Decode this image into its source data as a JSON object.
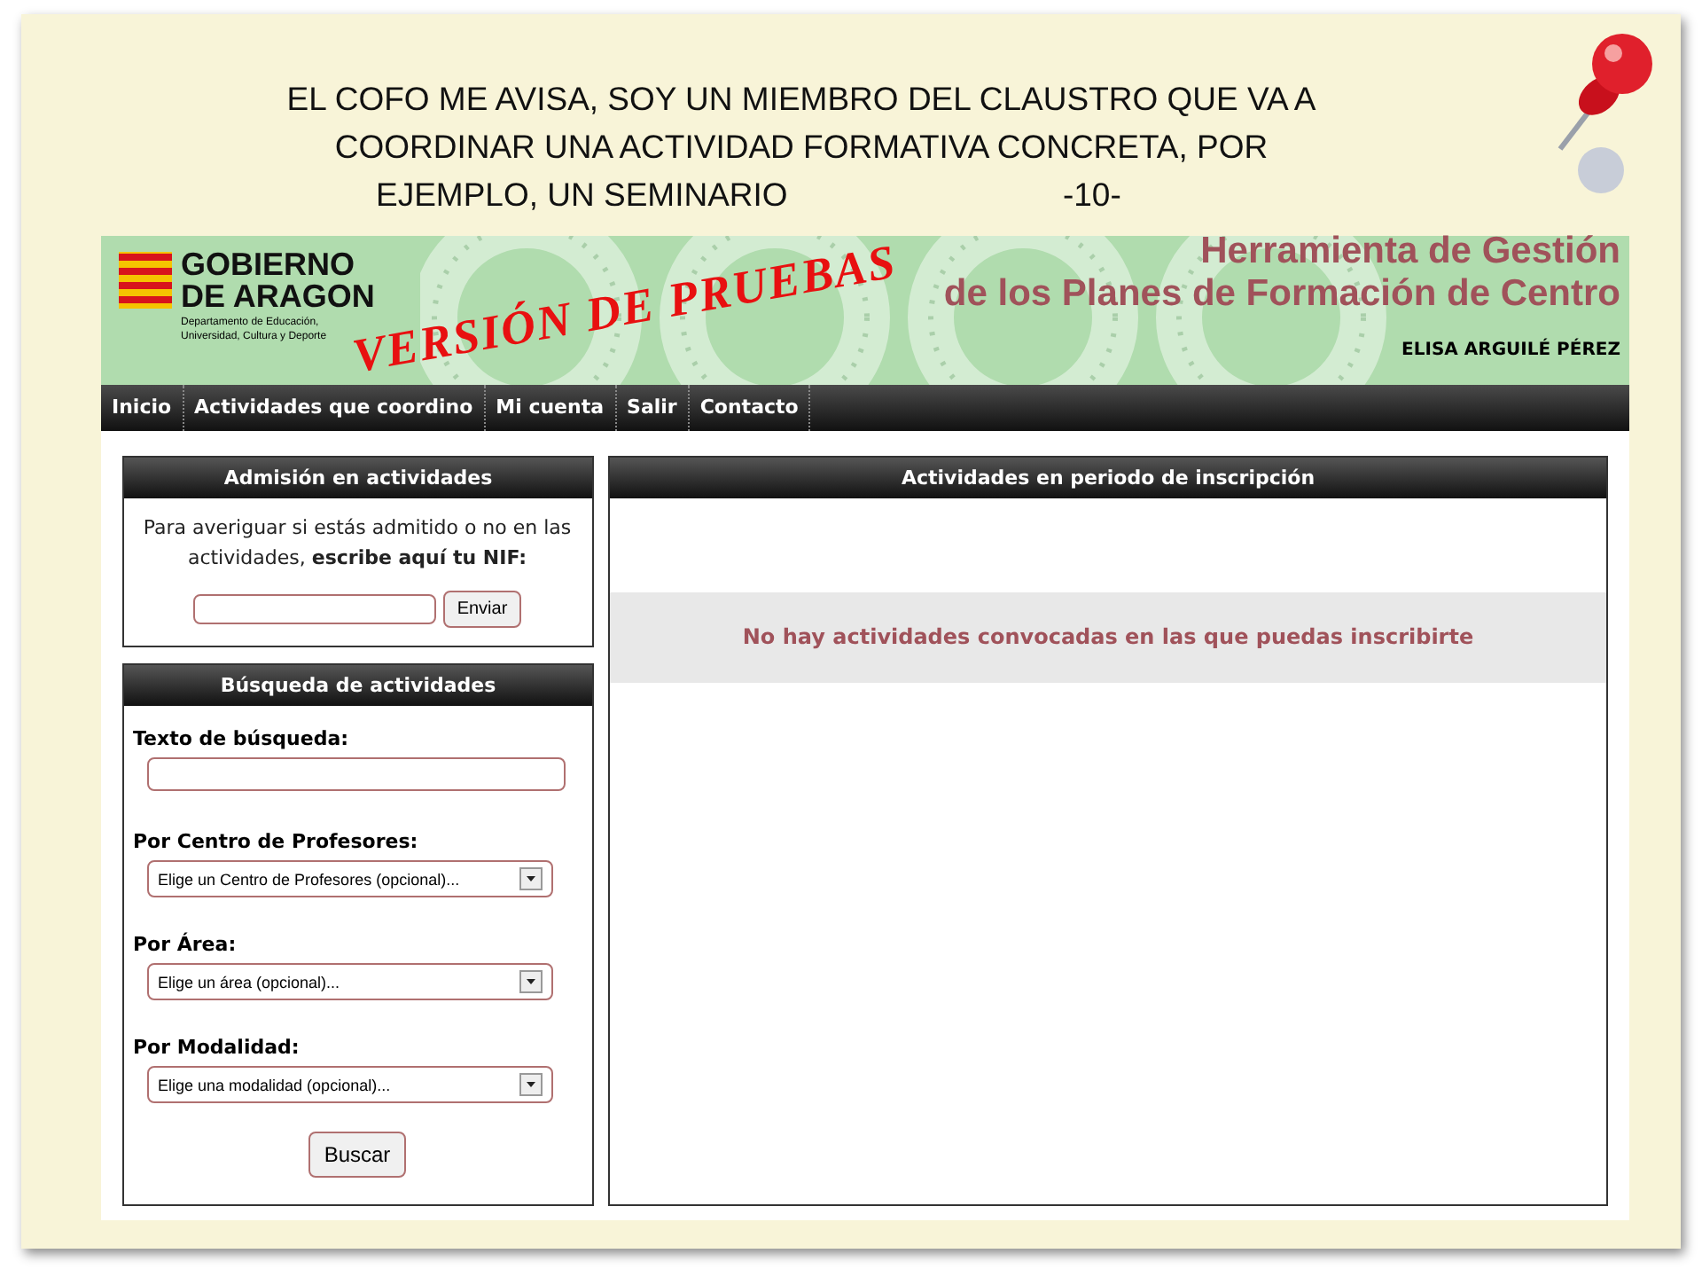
{
  "slide": {
    "title_lines": [
      "EL COFO ME AVISA, SOY UN MIEMBRO DEL CLAUSTRO QUE VA A",
      "COORDINAR UNA ACTIVIDAD FORMATIVA CONCRETA, POR",
      "EJEMPLO, UN SEMINARIO"
    ],
    "page_number": "-10-"
  },
  "header": {
    "logo_name_lines": [
      "GOBIERNO",
      "DE ARAGON"
    ],
    "logo_subtitle": "Departamento de Educación, Universidad, Cultura y Deporte",
    "stamp": "VERSIÓN DE PRUEBAS",
    "title_lines": [
      "Herramienta de Gestión",
      "de los Planes de Formación de Centro"
    ],
    "user": "ELISA ARGUILÉ PÉREZ"
  },
  "nav": [
    "Inicio",
    "Actividades que coordino",
    "Mi cuenta",
    "Salir",
    "Contacto"
  ],
  "admission": {
    "title": "Admisión en actividades",
    "text": "Para averiguar si estás admitido o no en las actividades, **escribe aquí tu NIF:**",
    "button": "Enviar"
  },
  "search": {
    "title": "Búsqueda de actividades",
    "fields": [
      {
        "kind": "text",
        "label": "Texto de búsqueda:"
      },
      {
        "kind": "select",
        "label": "Por Centro de Profesores:",
        "value": "Elige un Centro de Profesores (opcional)..."
      },
      {
        "kind": "select",
        "label": "Por Área:",
        "value": "Elige un área (opcional)..."
      },
      {
        "kind": "select",
        "label": "Por Modalidad:",
        "value": "Elige una modalidad (opcional)..."
      }
    ],
    "button": "Buscar"
  },
  "enrollment": {
    "title": "Actividades en periodo de inscripción",
    "message": "No hay actividades convocadas en las que puedas inscribirte"
  }
}
